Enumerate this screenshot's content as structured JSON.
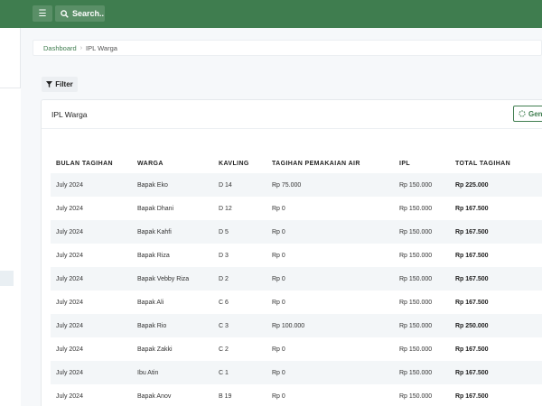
{
  "header": {
    "menu_icon": "hamburger-icon",
    "search_label": "Search..",
    "search_icon": "search-icon",
    "brand_color": "#3f7d4f"
  },
  "breadcrumb": {
    "home": "Dashboard",
    "current": "IPL Warga"
  },
  "toolbar": {
    "filter_label": "Filter",
    "filter_icon": "filter-icon"
  },
  "card": {
    "title": "IPL Warga",
    "generate_label": "Gene",
    "generate_icon": "spinner-icon"
  },
  "table": {
    "columns": [
      "BULAN TAGIHAN",
      "WARGA",
      "KAVLING",
      "TAGIHAN PEMAKAIAN AIR",
      "IPL",
      "TOTAL TAGIHAN"
    ],
    "rows": [
      [
        "July 2024",
        "Bapak Eko",
        "D 14",
        "Rp 75.000",
        "Rp 150.000",
        "Rp 225.000"
      ],
      [
        "July 2024",
        "Bapak Dhani",
        "D 12",
        "Rp 0",
        "Rp 150.000",
        "Rp 167.500"
      ],
      [
        "July 2024",
        "Bapak Kahfi",
        "D 5",
        "Rp 0",
        "Rp 150.000",
        "Rp 167.500"
      ],
      [
        "July 2024",
        "Bapak Riza",
        "D 3",
        "Rp 0",
        "Rp 150.000",
        "Rp 167.500"
      ],
      [
        "July 2024",
        "Bapak Vebby Riza",
        "D 2",
        "Rp 0",
        "Rp 150.000",
        "Rp 167.500"
      ],
      [
        "July 2024",
        "Bapak Ali",
        "C 6",
        "Rp 0",
        "Rp 150.000",
        "Rp 167.500"
      ],
      [
        "July 2024",
        "Bapak Rio",
        "C 3",
        "Rp 100.000",
        "Rp 150.000",
        "Rp 250.000"
      ],
      [
        "July 2024",
        "Bapak Zakki",
        "C 2",
        "Rp 0",
        "Rp 150.000",
        "Rp 167.500"
      ],
      [
        "July 2024",
        "Ibu Atin",
        "C 1",
        "Rp 0",
        "Rp 150.000",
        "Rp 167.500"
      ],
      [
        "July 2024",
        "Bapak Anov",
        "B 19",
        "Rp 0",
        "Rp 150.000",
        "Rp 167.500"
      ]
    ]
  }
}
